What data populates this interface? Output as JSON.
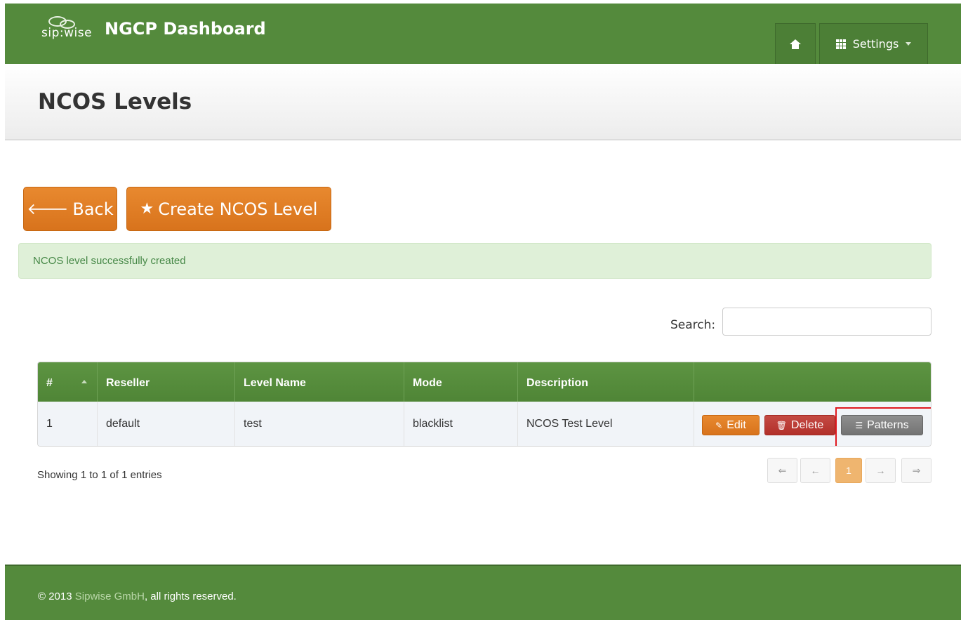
{
  "header": {
    "brand_logo_text": "sip:wise",
    "brand_title": "NGCP Dashboard",
    "settings_label": "Settings"
  },
  "page": {
    "title": "NCOS Levels"
  },
  "actions": {
    "back_label": "Back",
    "create_label": "Create NCOS Level"
  },
  "alert": {
    "message": "NCOS level successfully created"
  },
  "search": {
    "label": "Search:",
    "value": "",
    "placeholder": ""
  },
  "table": {
    "columns": [
      "#",
      "Reseller",
      "Level Name",
      "Mode",
      "Description",
      ""
    ],
    "rows": [
      {
        "id": "1",
        "reseller": "default",
        "level_name": "test",
        "mode": "blacklist",
        "description": "NCOS Test Level",
        "actions": {
          "edit": "Edit",
          "delete": "Delete",
          "patterns": "Patterns"
        }
      }
    ]
  },
  "pagination": {
    "info": "Showing 1 to 1 of 1 entries",
    "first": "⇐",
    "prev": "←",
    "current": "1",
    "next": "→",
    "last": "⇒"
  },
  "footer": {
    "prefix": "© 2013 ",
    "company": "Sipwise GmbH",
    "suffix": ", all rights reserved."
  },
  "colors": {
    "primary_green": "#548a3c",
    "accent_orange": "#e07f26",
    "danger_red": "#b2302a",
    "neutral_gray": "#737373",
    "alert_bg": "#dff0d8",
    "highlight_red": "#e0191f"
  }
}
